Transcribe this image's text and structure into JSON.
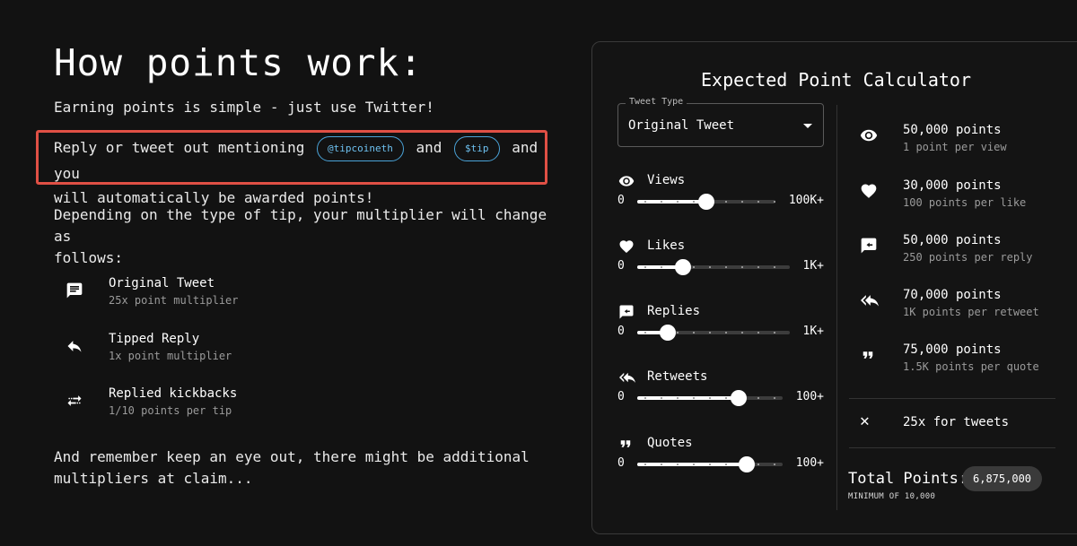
{
  "left": {
    "title": "How points work:",
    "intro": "Earning points is simple - just use Twitter!",
    "mention": {
      "prefix": "Reply or tweet out mentioning",
      "chip1": "@tipcoineth",
      "and": "and",
      "chip2": "$tip",
      "line_end": "and you",
      "line2": "will automatically be awarded points!"
    },
    "depending_line1": "Depending on the type of tip, your multiplier will change as",
    "depending_line2": "follows:",
    "multipliers": [
      {
        "icon": "message-icon",
        "name": "Original Tweet",
        "sub": "25x point multiplier"
      },
      {
        "icon": "reply-icon",
        "name": "Tipped Reply",
        "sub": "1x point multiplier"
      },
      {
        "icon": "swap-icon",
        "name": "Replied kickbacks",
        "sub": "1/10 points per tip"
      }
    ],
    "footer_line1": "And remember keep an eye out, there might be additional",
    "footer_line2": "multipliers at claim..."
  },
  "calculator": {
    "title": "Expected Point Calculator",
    "tweet_type": {
      "legend": "Tweet Type",
      "value": "Original Tweet"
    },
    "sliders": [
      {
        "icon": "eye-icon",
        "label": "Views",
        "min": "0",
        "max": "100K+",
        "level": 0.5
      },
      {
        "icon": "heart-icon",
        "label": "Likes",
        "min": "0",
        "max": "1K+",
        "level": 0.3
      },
      {
        "icon": "reply-bubble-icon",
        "label": "Replies",
        "min": "0",
        "max": "1K+",
        "level": 0.2
      },
      {
        "icon": "reply-all-icon",
        "label": "Retweets",
        "min": "0",
        "max": "100+",
        "level": 0.7
      },
      {
        "icon": "quote-icon",
        "label": "Quotes",
        "min": "0",
        "max": "100+",
        "level": 0.75
      }
    ],
    "results": [
      {
        "icon": "eye-icon",
        "points": "50,000 points",
        "rate": "1 point per view"
      },
      {
        "icon": "heart-icon",
        "points": "30,000 points",
        "rate": "100 points per like"
      },
      {
        "icon": "reply-bubble-icon",
        "points": "50,000 points",
        "rate": "250 points per reply"
      },
      {
        "icon": "reply-all-icon",
        "points": "70,000 points",
        "rate": "1K points per retweet"
      },
      {
        "icon": "quote-icon",
        "points": "75,000 points",
        "rate": "1.5K points per quote"
      }
    ],
    "multiplier": {
      "symbol": "✕",
      "text": "25x for tweets"
    },
    "total_label": "Total Points:",
    "total_value": "6,875,000",
    "minimum": "MINIMUM OF 10,000"
  },
  "colors": {
    "highlight": "#e05045",
    "chip": "#4aa3d8",
    "background": "#121212"
  }
}
